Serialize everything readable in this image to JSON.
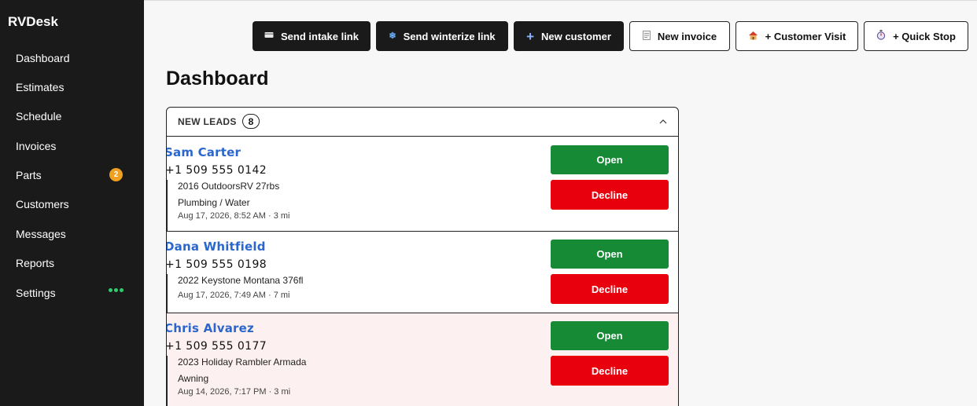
{
  "app": {
    "name": "RVDesk"
  },
  "sidebar": {
    "items": [
      {
        "label": "Dashboard"
      },
      {
        "label": "Estimates"
      },
      {
        "label": "Schedule"
      },
      {
        "label": "Invoices"
      },
      {
        "label": "Parts",
        "badge": "2"
      },
      {
        "label": "Customers"
      },
      {
        "label": "Messages"
      },
      {
        "label": "Reports"
      },
      {
        "label": "Settings"
      }
    ]
  },
  "toolbar": {
    "send_intake": {
      "label": "Send intake link",
      "icon": "card-icon"
    },
    "send_winterize": {
      "label": "Send winterize link",
      "icon": "snowflake-icon"
    },
    "new_customer": {
      "label": "New customer",
      "icon": "plus-icon"
    },
    "new_invoice": {
      "label": "New invoice",
      "icon": "receipt-icon"
    },
    "customer_visit": {
      "label": "+ Customer Visit",
      "icon": "house-icon"
    },
    "quick_stop": {
      "label": "+ Quick Stop",
      "icon": "stopwatch-icon"
    }
  },
  "page": {
    "title": "Dashboard"
  },
  "leads_panel": {
    "title": "NEW LEADS",
    "count": "8",
    "leads": [
      {
        "name": "Sam Carter",
        "phone": "+1 509 555 0142",
        "vehicle": "2016 OutdoorsRV 27rbs",
        "service": "Plumbing / Water",
        "meta": "Aug 17, 2026, 8:52 AM · 3 mi",
        "open_label": "Open",
        "decline_label": "Decline"
      },
      {
        "name": "Dana Whitfield",
        "phone": "+1 509 555 0198",
        "vehicle": "2022 Keystone Montana 376fl",
        "service": "",
        "meta": "Aug 17, 2026, 7:49 AM · 7 mi",
        "open_label": "Open",
        "decline_label": "Decline"
      },
      {
        "name": "Chris Alvarez",
        "phone": "+1 509 555 0177",
        "vehicle": "2023 Holiday Rambler Armada",
        "service": "Awning",
        "meta": "Aug 14, 2026, 7:17 PM · 3 mi",
        "open_label": "Open",
        "decline_label": "Decline"
      }
    ]
  },
  "colors": {
    "sidebar_bg": "#1a1a1a",
    "badge": "#f0a020",
    "settings_dots": "#2ecc71",
    "lead_name": "#2a66cc",
    "open": "#168a35",
    "decline": "#e8000d",
    "highlight_row": "#fdf0f0"
  }
}
